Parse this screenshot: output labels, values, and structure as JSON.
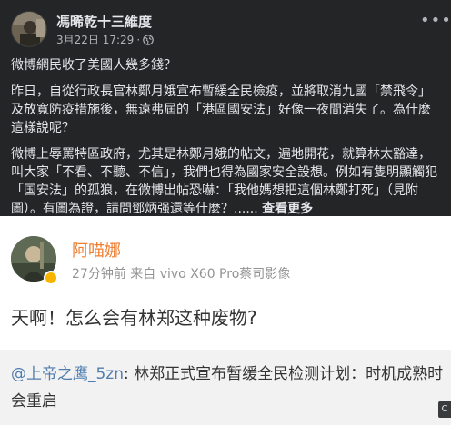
{
  "facebook_post": {
    "author": "馮晞乾十三維度",
    "date": "3月22日 17:29",
    "separator": " · ",
    "privacy_icon": "globe-icon",
    "more_icon": "more-options-icon",
    "paragraphs": [
      "微博網民收了美國人幾多錢？",
      "昨日，自從行政長官林鄭月娥宣布暫緩全民檢疫，並將取消九國「禁飛令」及放寬防疫措施後，無遠弗屆的「港區國安法」好像一夜間消失了。為什麼這樣說呢？",
      "微博上辱罵特區政府，尤其是林鄭月娥的帖文，遍地開花，就算林太豁達，叫大家「不看、不聽、不信」，我們也得為國家安全設想。例如有隻明顯觸犯「国安法」的孤狼，在微博出帖恐嚇：「我他媽想把這個林鄭打死」（見附圖）。有圖為證，請問鄧炳强還等什麼？......"
    ],
    "see_more": "查看更多"
  },
  "weibo_screenshot": {
    "user_name": "阿喵娜",
    "meta": "27分钟前 来自 vivo X60 Pro蔡司影像",
    "content": "天啊！怎么会有林郑这种废物?",
    "repost_mention": "@上帝之鹰_5zn",
    "repost_text": ": 林郑正式宣布暂缓全民检测计划：时机成熟时会重启"
  },
  "corner_tab_label": "C",
  "colors": {
    "fb_background": "#242526",
    "fb_text": "#e4e6eb",
    "fb_meta": "#b0b3b8",
    "weibo_name": "#f07c2e",
    "weibo_mention": "#507daf",
    "weibo_repost_bg": "#f2f2f2"
  }
}
